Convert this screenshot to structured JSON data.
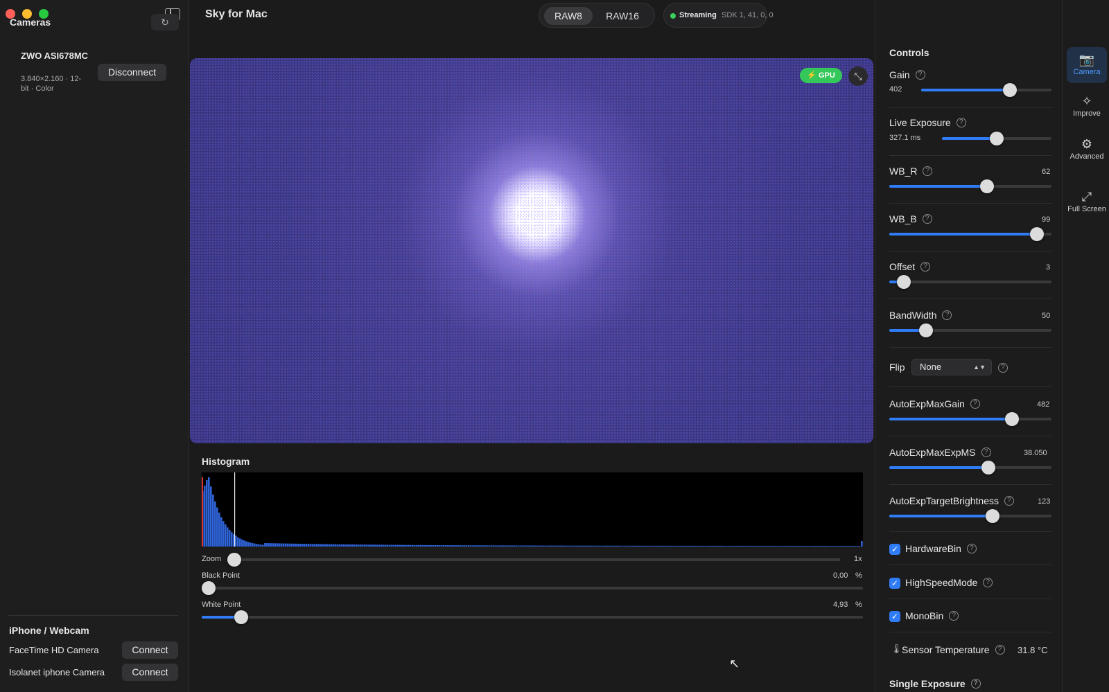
{
  "app": {
    "title": "Sky for Mac"
  },
  "sidebar": {
    "title": "Cameras",
    "camera": {
      "name": "ZWO ASI678MC",
      "spec": "3.840×2.160 · 12-bit · Color",
      "disconnect_label": "Disconnect"
    },
    "webcam_section": "iPhone / Webcam",
    "webcams": [
      {
        "name": "FaceTime HD Camera",
        "button": "Connect"
      },
      {
        "name": "Isolanet iphone Camera",
        "button": "Connect"
      }
    ]
  },
  "toolbar": {
    "format_tabs": [
      "RAW8",
      "RAW16"
    ],
    "selected_format": "RAW8",
    "status_label": "Streaming",
    "sdk": "SDK 1, 41, 0, 0",
    "status_color": "#3ecf5a"
  },
  "preview": {
    "gpu_label": "GPU"
  },
  "histogram": {
    "title": "Histogram",
    "zoom_label": "Zoom",
    "zoom_value": "1x",
    "zoom_level": 0,
    "black_label": "Black Point",
    "black_value": "0,00",
    "black_unit": "%",
    "black_level": 0.0,
    "white_label": "White Point",
    "white_value": "4,93",
    "white_unit": "%",
    "white_level": 0.0493
  },
  "controls": {
    "title": "Controls",
    "gain": {
      "label": "Gain",
      "value": "402",
      "level": 0.7
    },
    "live_exposure": {
      "label": "Live Exposure",
      "value": "327.1 ms",
      "level": 0.5
    },
    "wb_r": {
      "label": "WB_R",
      "value": "62",
      "level": 0.61
    },
    "wb_b": {
      "label": "WB_B",
      "value": "99",
      "level": 0.95
    },
    "offset": {
      "label": "Offset",
      "value": "3",
      "level": 0.05
    },
    "bandwidth": {
      "label": "BandWidth",
      "value": "50",
      "level": 0.2
    },
    "flip": {
      "label": "Flip",
      "value": "None"
    },
    "ae_max_gain": {
      "label": "AutoExpMaxGain",
      "value": "482",
      "level": 0.78
    },
    "ae_max_exp": {
      "label": "AutoExpMaxExpMS",
      "value": "38.050",
      "level": 0.62
    },
    "ae_target": {
      "label": "AutoExpTargetBrightness",
      "value": "123",
      "level": 0.65
    },
    "hardware_bin": {
      "label": "HardwareBin",
      "checked": true
    },
    "high_speed": {
      "label": "HighSpeedMode",
      "checked": true
    },
    "mono_bin": {
      "label": "MonoBin",
      "checked": true
    },
    "sensor_temp": {
      "label": "Sensor Temperature",
      "value": "31.8 °C"
    },
    "single_exposure": {
      "label": "Single Exposure"
    }
  },
  "rail": {
    "items": [
      {
        "label": "Camera",
        "icon": "camera-icon"
      },
      {
        "label": "Improve",
        "icon": "magic-wand-icon"
      },
      {
        "label": "Advanced",
        "icon": "gears-icon"
      },
      {
        "label": "Full Screen",
        "icon": "expand-icon"
      }
    ]
  },
  "colors": {
    "accent": "#2f7cf6",
    "gpu": "#34c759",
    "preview_bg": "#3d3a84"
  }
}
